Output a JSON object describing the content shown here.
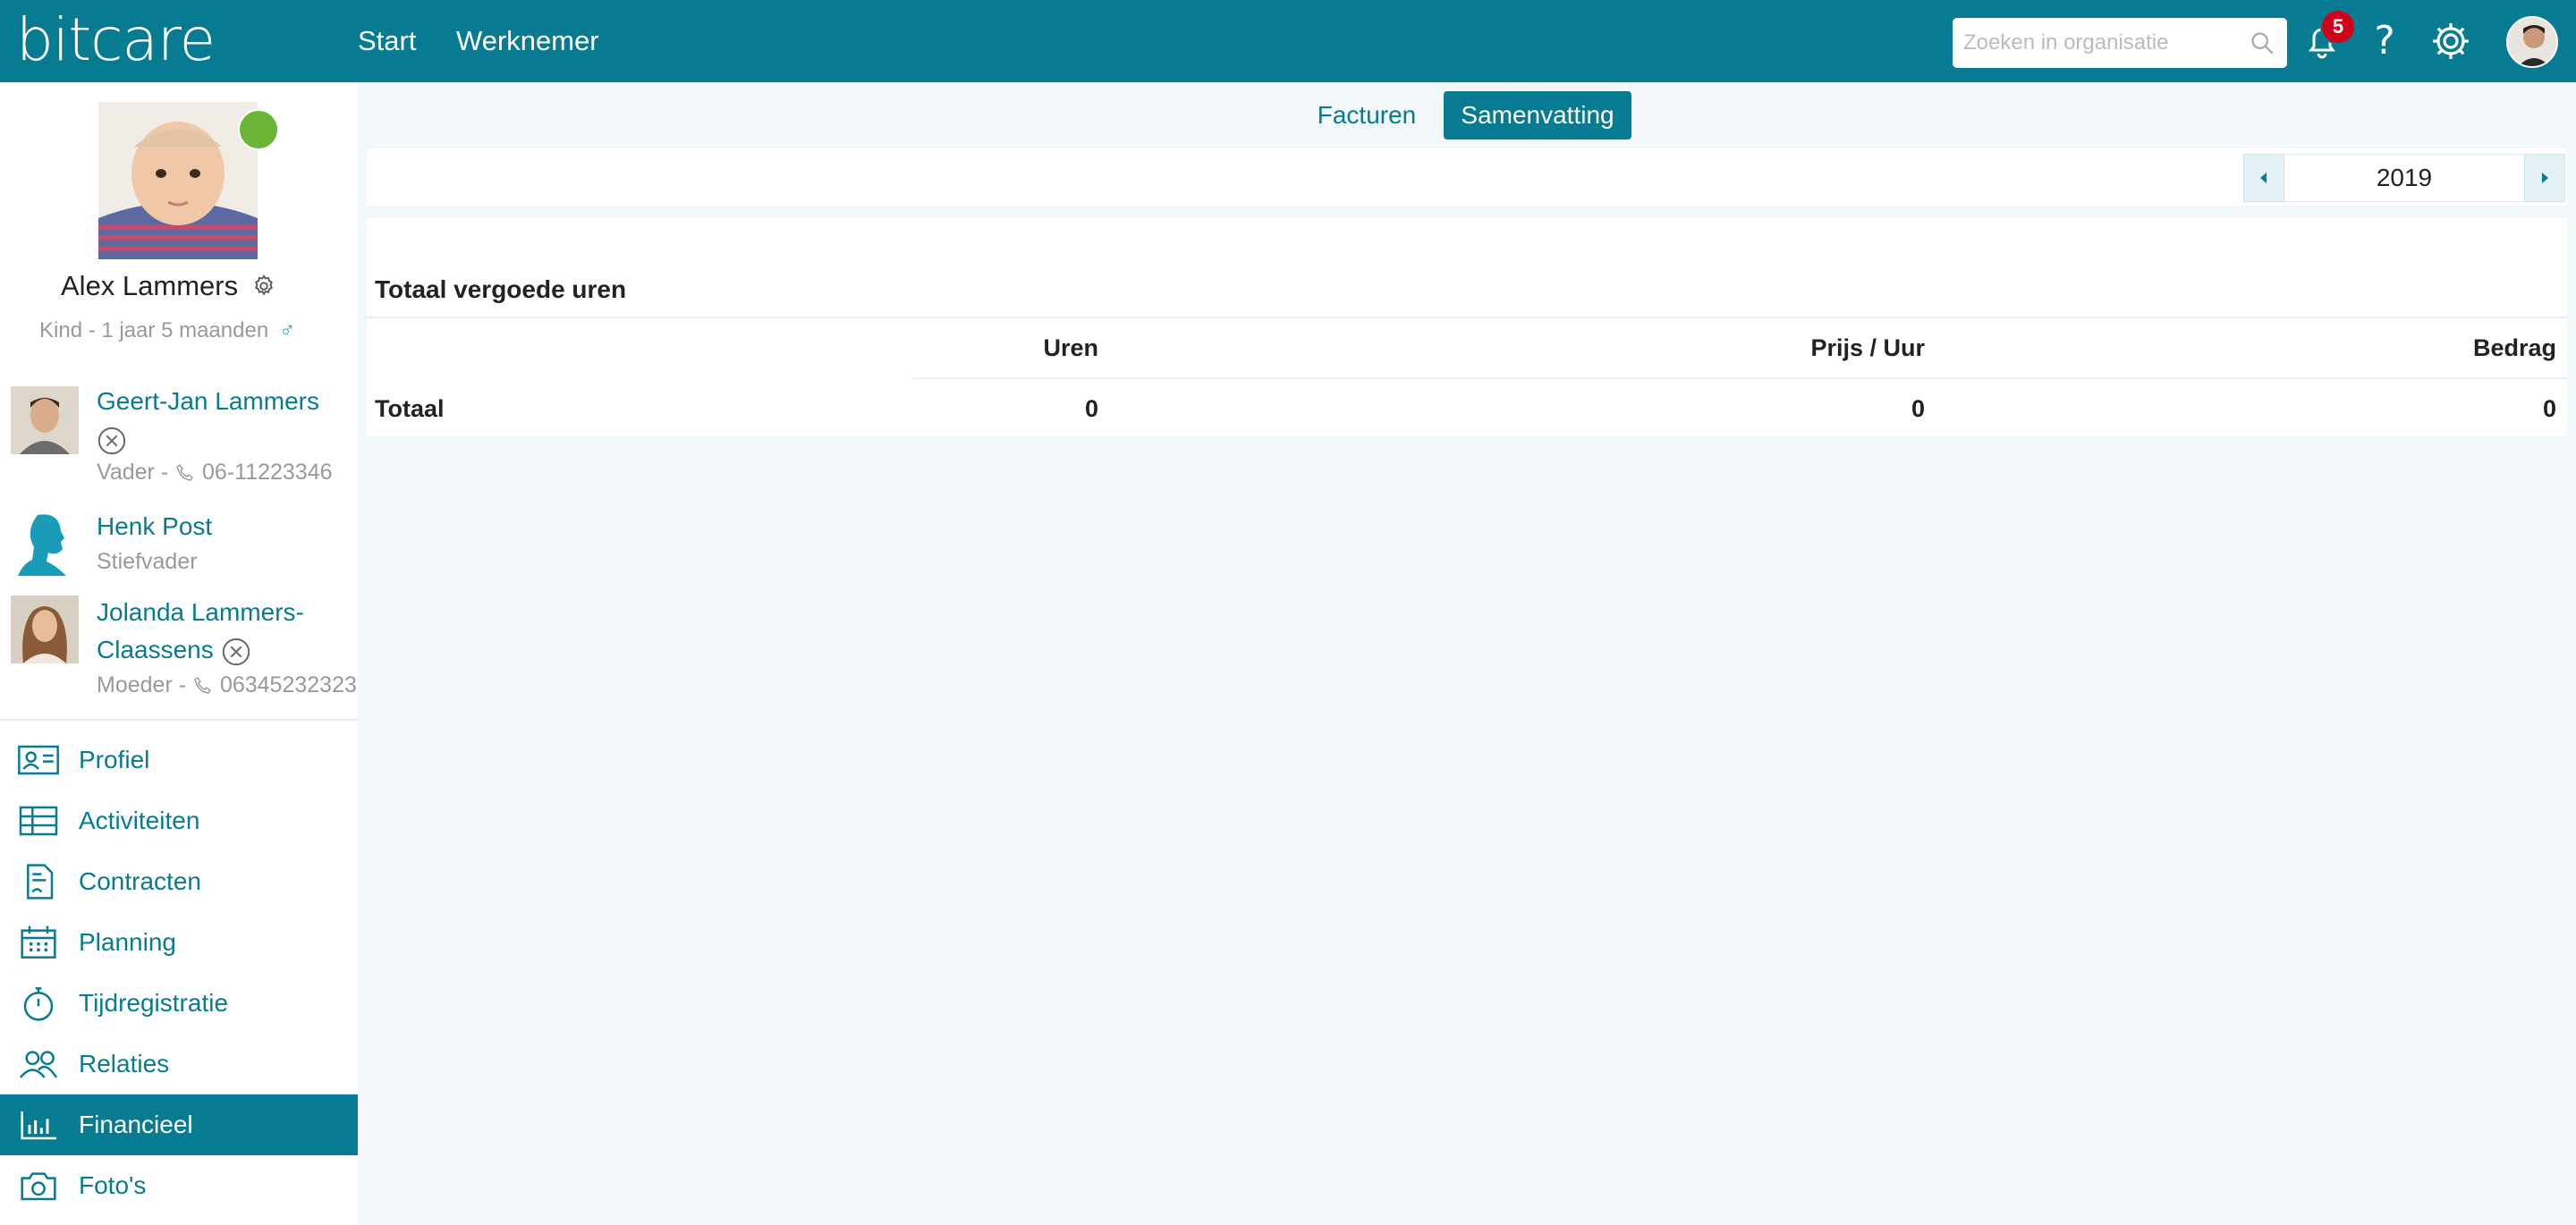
{
  "header": {
    "logo": "bitcare",
    "nav": [
      "Start",
      "Werknemer"
    ],
    "search_placeholder": "Zoeken in organisatie",
    "notification_count": "5",
    "help": "?"
  },
  "child": {
    "name": "Alex Lammers",
    "subtitle": "Kind - 1 jaar 5 maanden",
    "gender_symbol": "♂"
  },
  "relations": [
    {
      "name": "Geert-Jan Lammers",
      "role": "Vader - ",
      "phone": "06-11223346"
    },
    {
      "name": "Henk Post",
      "role": "Stiefvader"
    },
    {
      "name": "Jolanda Lammers-Claassens",
      "role": "Moeder - ",
      "phone": "06345232323"
    }
  ],
  "menu": [
    {
      "label": "Profiel",
      "icon": "id-card-icon"
    },
    {
      "label": "Activiteiten",
      "icon": "table-icon"
    },
    {
      "label": "Contracten",
      "icon": "document-icon"
    },
    {
      "label": "Planning",
      "icon": "calendar-icon"
    },
    {
      "label": "Tijdregistratie",
      "icon": "stopwatch-icon"
    },
    {
      "label": "Relaties",
      "icon": "people-icon"
    },
    {
      "label": "Financieel",
      "icon": "bar-chart-icon",
      "active": true
    },
    {
      "label": "Foto's",
      "icon": "camera-icon"
    }
  ],
  "tabs": [
    "Facturen",
    "Samenvatting"
  ],
  "year": "2019",
  "summary": {
    "title": "Totaal vergoede uren",
    "columns": [
      "Uren",
      "Prijs / Uur",
      "Bedrag"
    ],
    "total_label": "Totaal",
    "total_values": [
      "0",
      "0",
      "0"
    ]
  },
  "colors": {
    "primary": "#077b91",
    "status_green": "#6ab536",
    "badge_red": "#d0021b"
  }
}
